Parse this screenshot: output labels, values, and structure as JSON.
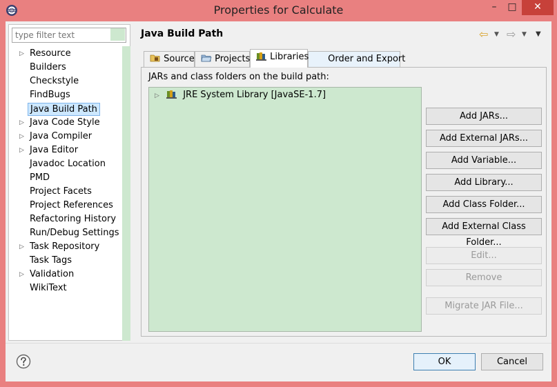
{
  "window": {
    "title": "Properties for Calculate",
    "minimize": "–",
    "maximize": "□",
    "close": "✕"
  },
  "filter": {
    "placeholder": "type filter text"
  },
  "tree": {
    "items": [
      {
        "label": "Resource",
        "expandable": true
      },
      {
        "label": "Builders",
        "expandable": false
      },
      {
        "label": "Checkstyle",
        "expandable": false
      },
      {
        "label": "FindBugs",
        "expandable": false
      },
      {
        "label": "Java Build Path",
        "expandable": false,
        "selected": true
      },
      {
        "label": "Java Code Style",
        "expandable": true
      },
      {
        "label": "Java Compiler",
        "expandable": true
      },
      {
        "label": "Java Editor",
        "expandable": true
      },
      {
        "label": "Javadoc Location",
        "expandable": false
      },
      {
        "label": "PMD",
        "expandable": false
      },
      {
        "label": "Project Facets",
        "expandable": false
      },
      {
        "label": "Project References",
        "expandable": false
      },
      {
        "label": "Refactoring History",
        "expandable": false
      },
      {
        "label": "Run/Debug Settings",
        "expandable": false
      },
      {
        "label": "Task Repository",
        "expandable": true
      },
      {
        "label": "Task Tags",
        "expandable": false
      },
      {
        "label": "Validation",
        "expandable": true
      },
      {
        "label": "WikiText",
        "expandable": false
      }
    ]
  },
  "page": {
    "title": "Java Build Path"
  },
  "nav": {
    "back": "⇦",
    "forward": "⇨",
    "dropdown": "▼",
    "menu": "▼"
  },
  "tabs": [
    {
      "label": "Source"
    },
    {
      "label": "Projects"
    },
    {
      "label": "Libraries",
      "active": true
    },
    {
      "label": "Order and Export"
    }
  ],
  "libraries": {
    "heading": "JARs and class folders on the build path:",
    "entries": [
      {
        "label": "JRE System Library [JavaSE-1.7]"
      }
    ],
    "buttons": {
      "add_jars": "Add JARs...",
      "add_external_jars": "Add External JARs...",
      "add_variable": "Add Variable...",
      "add_library": "Add Library...",
      "add_class_folder": "Add Class Folder...",
      "add_external_class_folder": "Add External Class Folder...",
      "edit": "Edit...",
      "remove": "Remove",
      "migrate_jar": "Migrate JAR File..."
    }
  },
  "dialog": {
    "ok": "OK",
    "cancel": "Cancel"
  },
  "colors": {
    "window_frame": "#e98080",
    "list_background": "#cde8cf",
    "selection": "#cde8ff",
    "close_button": "#c7413a"
  }
}
